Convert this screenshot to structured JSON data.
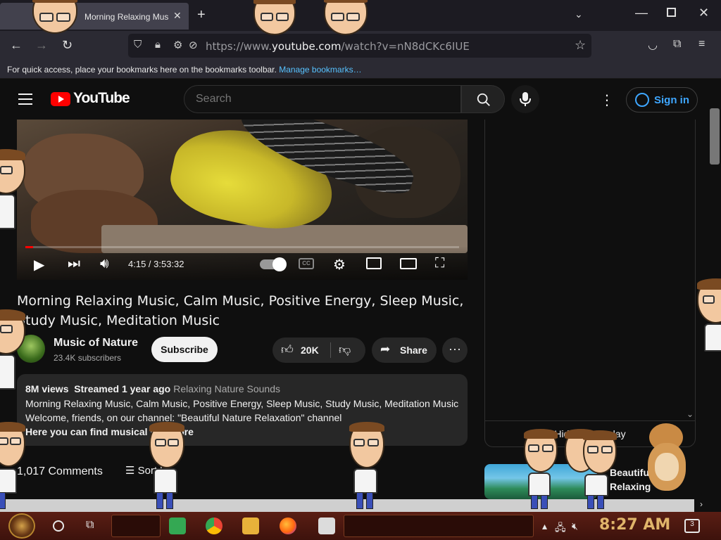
{
  "browser": {
    "tab_title": "Morning Relaxing Music, Calm",
    "url_prefix": "https://www.",
    "url_domain": "youtube.com",
    "url_path": "/watch?v=nN8dCKc6IUE",
    "bookmark_hint": "For quick access, place your bookmarks here on the bookmarks toolbar.",
    "bookmark_link": "Manage bookmarks…"
  },
  "yt": {
    "wordmark": "YouTube",
    "search_placeholder": "Search",
    "signin": "Sign in"
  },
  "player": {
    "time": "4:15 / 3:53:32",
    "progress": 0.018,
    "cc_label": "CC"
  },
  "video": {
    "title": "Morning Relaxing Music, Calm Music, Positive Energy, Sleep Music, Study Music, Meditation Music",
    "channel": "Music of Nature",
    "subscribers": "23.4K subscribers",
    "subscribe": "Subscribe",
    "likes": "20K",
    "share": "Share",
    "views": "8M views",
    "streamed": "Streamed 1 year ago",
    "tag": "Relaxing Nature Sounds",
    "desc_line1": "Morning Relaxing Music, Calm Music, Positive Energy, Sleep Music, Study Music, Meditation Music",
    "desc_line2": "Welcome, friends, on our channel: \"Beautiful Nature Relaxation\" channel",
    "desc_line3": "Here you can find musical vi",
    "desc_more": "...more"
  },
  "comments": {
    "count": "1,017 Comments",
    "sort": "Sort by"
  },
  "sidebar": {
    "chat_toggle": "Hide chat replay",
    "rec_title_1": "Beautiful",
    "rec_title_2": "Relaxing"
  },
  "taskbar": {
    "clock": "8:27 AM",
    "notif_count": "3"
  },
  "colors": {
    "accent": "#3ea6ff",
    "yt_red": "#ff0000",
    "clock": "#e0b46a"
  }
}
